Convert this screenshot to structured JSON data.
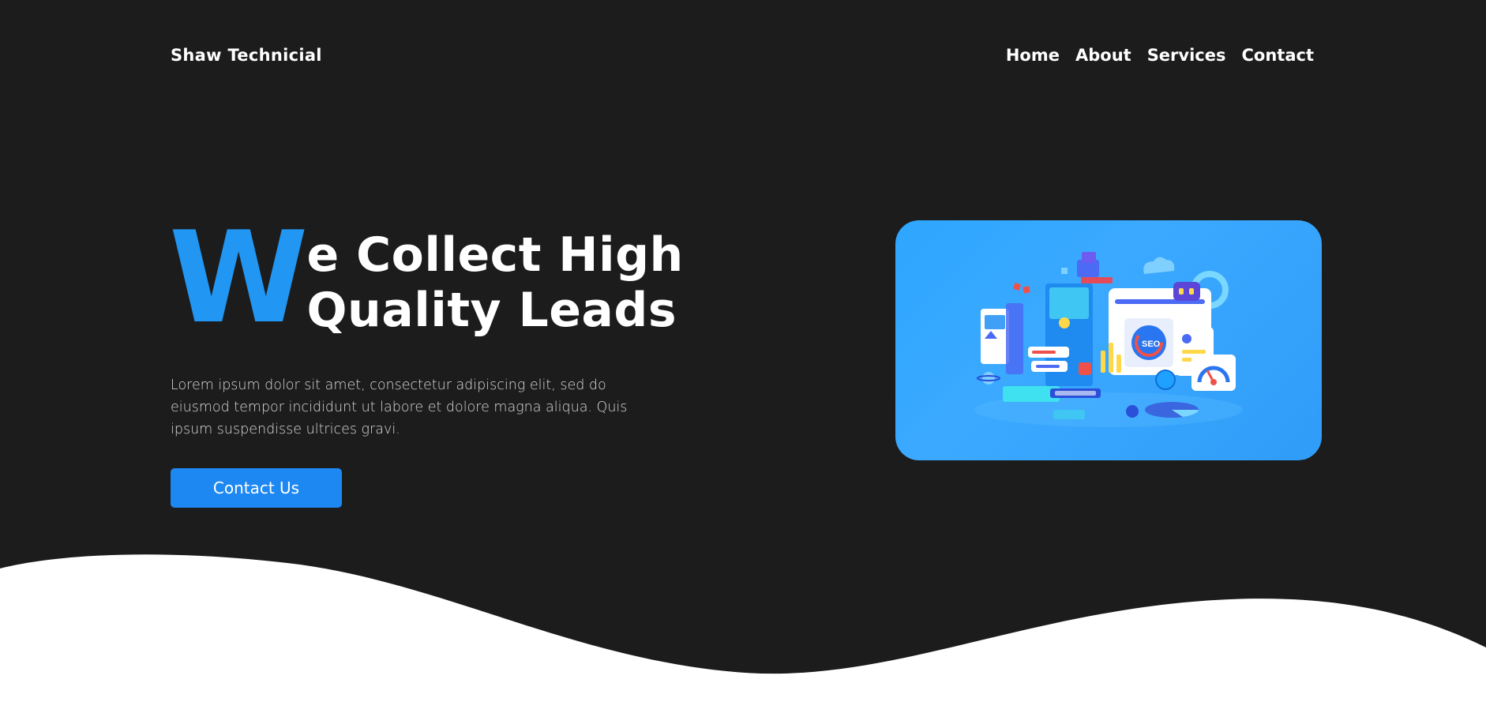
{
  "header": {
    "brand": "Shaw Technicial",
    "nav": [
      {
        "label": "Home"
      },
      {
        "label": "About"
      },
      {
        "label": "Services"
      },
      {
        "label": "Contact"
      }
    ]
  },
  "hero": {
    "title_initial": "W",
    "title_line1": "e Collect High",
    "title_line2": "Quality Leads",
    "description": "Lorem ipsum dolor sit amet, consectetur adipiscing elit, sed do eiusmod tempor incididunt ut labore et dolore magna aliqua. Quis ipsum suspendisse ultrices gravi.",
    "cta_label": "Contact Us",
    "illustration_badge": "SEO"
  },
  "colors": {
    "background": "#1c1c1c",
    "accent": "#2196f3",
    "button": "#1e88f2",
    "card": "#2ea6ff",
    "wave": "#ffffff"
  }
}
